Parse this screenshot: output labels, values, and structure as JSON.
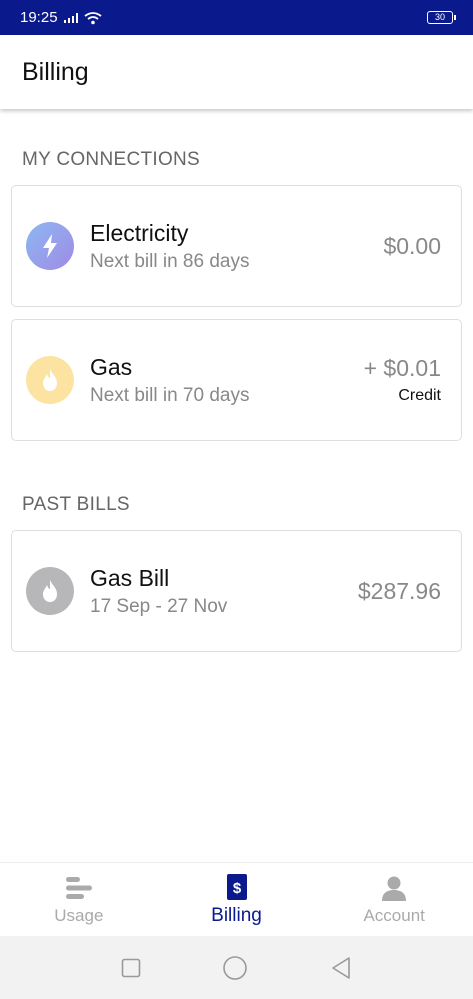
{
  "status_bar": {
    "time": "19:25",
    "battery": "30"
  },
  "app_bar": {
    "title": "Billing"
  },
  "connections": {
    "heading": "MY CONNECTIONS",
    "items": [
      {
        "title": "Electricity",
        "subtitle": "Next bill in 86 days",
        "amount": "$0.00",
        "note": "",
        "icon": "lightning-icon",
        "icon_color": "#7f9de8"
      },
      {
        "title": "Gas",
        "subtitle": "Next bill in 70 days",
        "amount": "+ $0.01",
        "note": "Credit",
        "icon": "flame-icon",
        "icon_color": "#fde3a2"
      }
    ]
  },
  "past_bills": {
    "heading": "PAST BILLS",
    "items": [
      {
        "title": "Gas Bill",
        "subtitle": "17 Sep - 27 Nov",
        "amount": "$287.96",
        "icon": "flame-icon",
        "icon_color": "#b7b7b9"
      }
    ]
  },
  "bottom_nav": {
    "items": [
      {
        "label": "Usage",
        "icon": "usage-bars-icon",
        "active": false
      },
      {
        "label": "Billing",
        "icon": "dollar-icon",
        "active": true
      },
      {
        "label": "Account",
        "icon": "person-icon",
        "active": false
      }
    ]
  },
  "colors": {
    "brand": "#0a1a8c",
    "muted_text": "#888888"
  }
}
